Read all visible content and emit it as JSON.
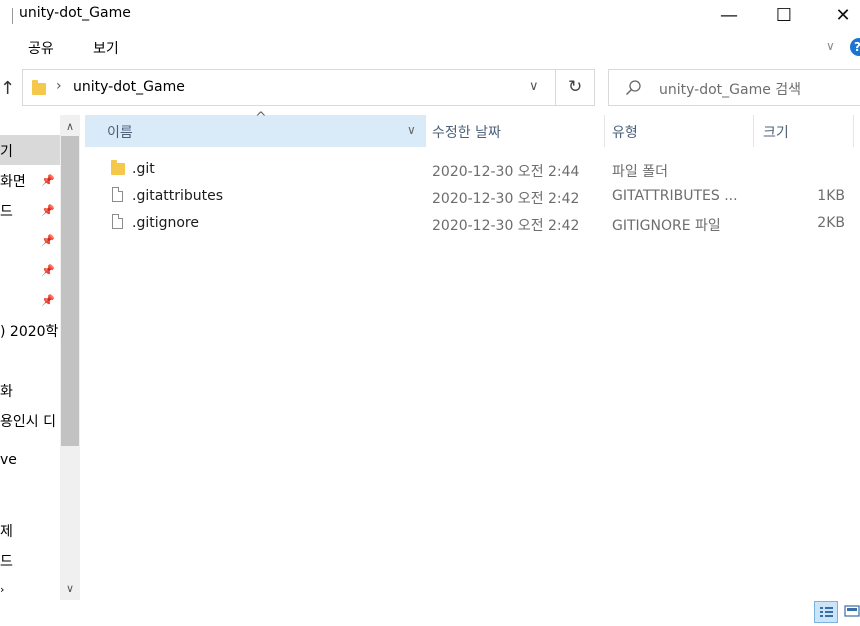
{
  "window": {
    "title": "unity-dot_Game",
    "minimize_glyph": "—",
    "maximize_glyph": "☐",
    "close_glyph": "✕"
  },
  "ribbon": {
    "tabs": [
      "공유",
      "보기"
    ],
    "expand_glyph": "∨",
    "help_glyph": "?"
  },
  "address": {
    "path_segments": [
      "unity-dot_Game"
    ],
    "separator": "›",
    "dropdown_glyph": "∨",
    "refresh_glyph": "↻",
    "up_glyph": "↑"
  },
  "search": {
    "placeholder": "unity-dot_Game 검색",
    "icon": "search-icon"
  },
  "nav": {
    "items": [
      {
        "label": "기",
        "pinned": false
      },
      {
        "label": "화면",
        "pinned": true
      },
      {
        "label": "드",
        "pinned": true
      },
      {
        "label": "",
        "pinned": true
      },
      {
        "label": "",
        "pinned": true
      },
      {
        "label": "",
        "pinned": true
      },
      {
        "label": ") 2020학",
        "pinned": false
      },
      {
        "label": "화",
        "pinned": false
      },
      {
        "label": "용인시 디",
        "pinned": false
      },
      {
        "label": "ve",
        "pinned": false
      },
      {
        "label": "제",
        "pinned": false
      },
      {
        "label": "드",
        "pinned": false
      }
    ],
    "scroll_up_glyph": "∧",
    "scroll_down_glyph": "∨"
  },
  "columns": {
    "name": "이름",
    "modified": "수정한 날짜",
    "type": "유형",
    "size": "크기",
    "sort_glyph": "^",
    "dropdown_glyph": "∨"
  },
  "files": [
    {
      "name": ".git",
      "modified": "2020-12-30 오전 2:44",
      "type": "파일 폴더",
      "size": "",
      "icon": "folder-icon"
    },
    {
      "name": ".gitattributes",
      "modified": "2020-12-30 오전 2:42",
      "type": "GITATTRIBUTES ...",
      "size": "1KB",
      "icon": "file-icon"
    },
    {
      "name": ".gitignore",
      "modified": "2020-12-30 오전 2:42",
      "type": "GITIGNORE 파일",
      "size": "2KB",
      "icon": "file-icon"
    }
  ],
  "status": {
    "views": [
      "details-view-icon",
      "large-icons-view-icon"
    ]
  },
  "colors": {
    "accent": "#1a75d2",
    "header_selected": "#d9ebf9",
    "folder": "#f4c84a"
  }
}
